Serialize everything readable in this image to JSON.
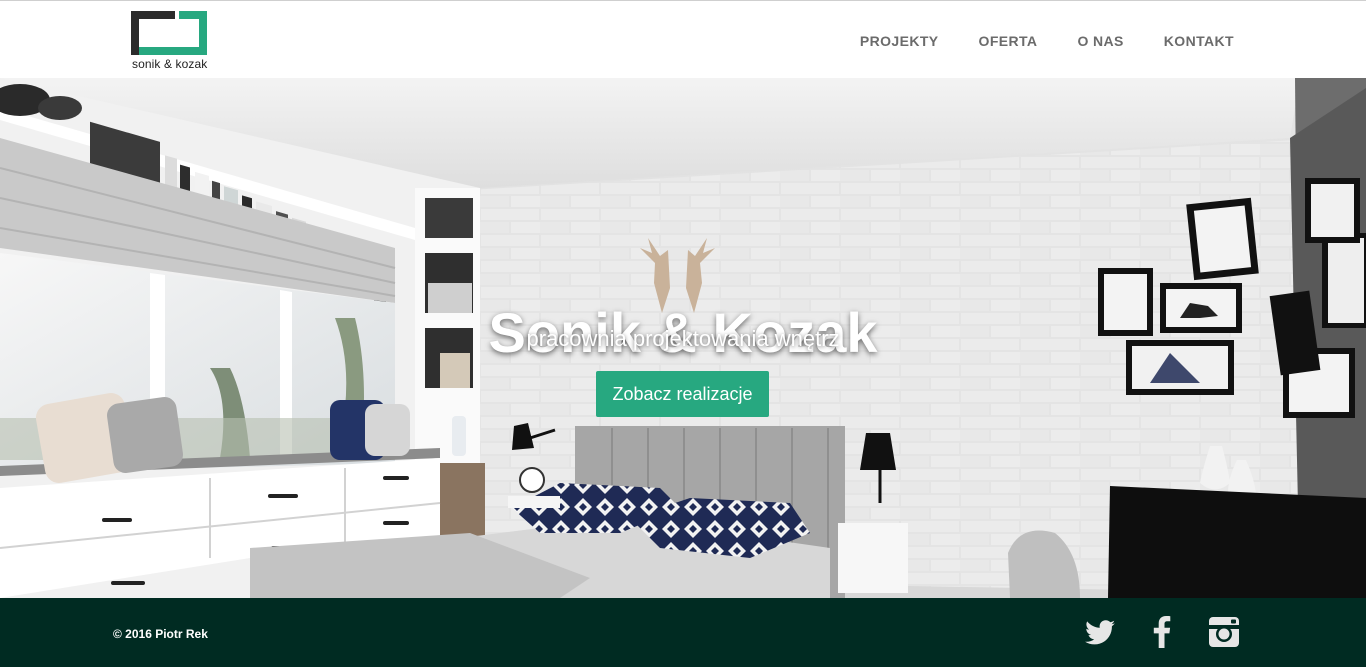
{
  "brand": {
    "name": "sonik & kozak",
    "colors": {
      "accent": "#27a880",
      "footer_bg": "#002b22",
      "nav_text": "#6b6b6b",
      "logo_dark": "#2b2b2b"
    }
  },
  "nav": {
    "items": [
      {
        "label": "PROJEKTY"
      },
      {
        "label": "OFERTA"
      },
      {
        "label": "O NAS"
      },
      {
        "label": "KONTAKT"
      }
    ]
  },
  "hero": {
    "title": "Sonik & Kozak",
    "subtitle": "pracownia projektowania wnętrz",
    "cta_label": "Zobacz realizacje"
  },
  "footer": {
    "copyright": "© 2016 Piotr Rek",
    "social": [
      {
        "icon": "twitter-icon"
      },
      {
        "icon": "facebook-icon"
      },
      {
        "icon": "instagram-icon"
      }
    ]
  }
}
